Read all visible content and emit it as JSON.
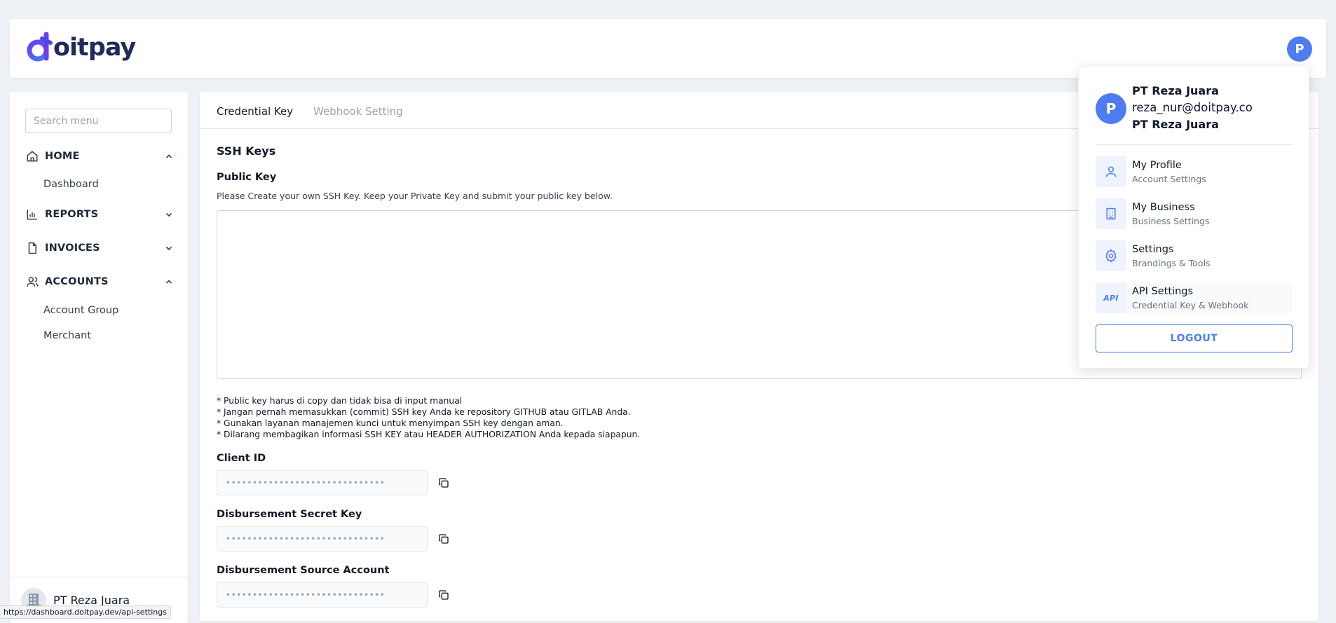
{
  "brand": {
    "logo_text": "oitpay",
    "logo_mark": "d"
  },
  "user": {
    "avatar_letter": "P"
  },
  "search": {
    "placeholder": "Search menu"
  },
  "sidebar": {
    "groups": [
      {
        "label": "HOME",
        "icon": "home-icon",
        "expanded": true,
        "items": [
          "Dashboard"
        ]
      },
      {
        "label": "REPORTS",
        "icon": "bar-chart-icon",
        "expanded": false,
        "items": []
      },
      {
        "label": "INVOICES",
        "icon": "document-icon",
        "expanded": false,
        "items": []
      },
      {
        "label": "ACCOUNTS",
        "icon": "users-icon",
        "expanded": true,
        "items": [
          "Account Group",
          "Merchant"
        ]
      }
    ],
    "footer_name": "PT Reza Juara"
  },
  "tabs": [
    {
      "label": "Credential Key",
      "active": true
    },
    {
      "label": "Webhook Setting",
      "active": false
    }
  ],
  "main": {
    "section_title": "SSH Keys",
    "public_key_label": "Public Key",
    "public_key_hint": "Please Create your own SSH Key. Keep your Private Key and submit your public key below.",
    "public_key_value": "",
    "notes": [
      "* Public key harus di copy dan tidak bisa di input manual",
      "* Jangan pernah memasukkan (commit) SSH key Anda ke repository GITHUB atau GITLAB Anda.",
      "* Gunakan layanan manajemen kunci untuk menyimpan SSH key dengan aman.",
      "* Dilarang membagikan informasi SSH KEY atau HEADER AUTHORIZATION Anda kepada siapapun."
    ],
    "fields": [
      {
        "label": "Client ID",
        "masked": "••••••••••••••••••••••••••••••"
      },
      {
        "label": "Disbursement Secret Key",
        "masked": "••••••••••••••••••••••••••••••"
      },
      {
        "label": "Disbursement Source Account",
        "masked": "••••••••••••••••••••••••••••••"
      }
    ]
  },
  "dropdown": {
    "avatar_letter": "P",
    "name": "PT Reza Juara",
    "email": "reza_nur@doitpay.co",
    "company": "PT Reza Juara",
    "items": [
      {
        "title": "My Profile",
        "subtitle": "Account Settings",
        "icon": "user-icon"
      },
      {
        "title": "My Business",
        "subtitle": "Business Settings",
        "icon": "building-icon"
      },
      {
        "title": "Settings",
        "subtitle": "Brandings & Tools",
        "icon": "gear-icon"
      },
      {
        "title": "API Settings",
        "subtitle": "Credential Key & Webhook",
        "icon": "api-icon",
        "icon_text": "API"
      }
    ],
    "logout_label": "LOGOUT"
  },
  "status_url": "https://dashboard.doitpay.dev/api-settings",
  "colors": {
    "accent": "#4e7cf1",
    "brand_navy": "#1f2b5b",
    "brand_purple": "#6b3df0",
    "brand_blue": "#3b82f6"
  }
}
